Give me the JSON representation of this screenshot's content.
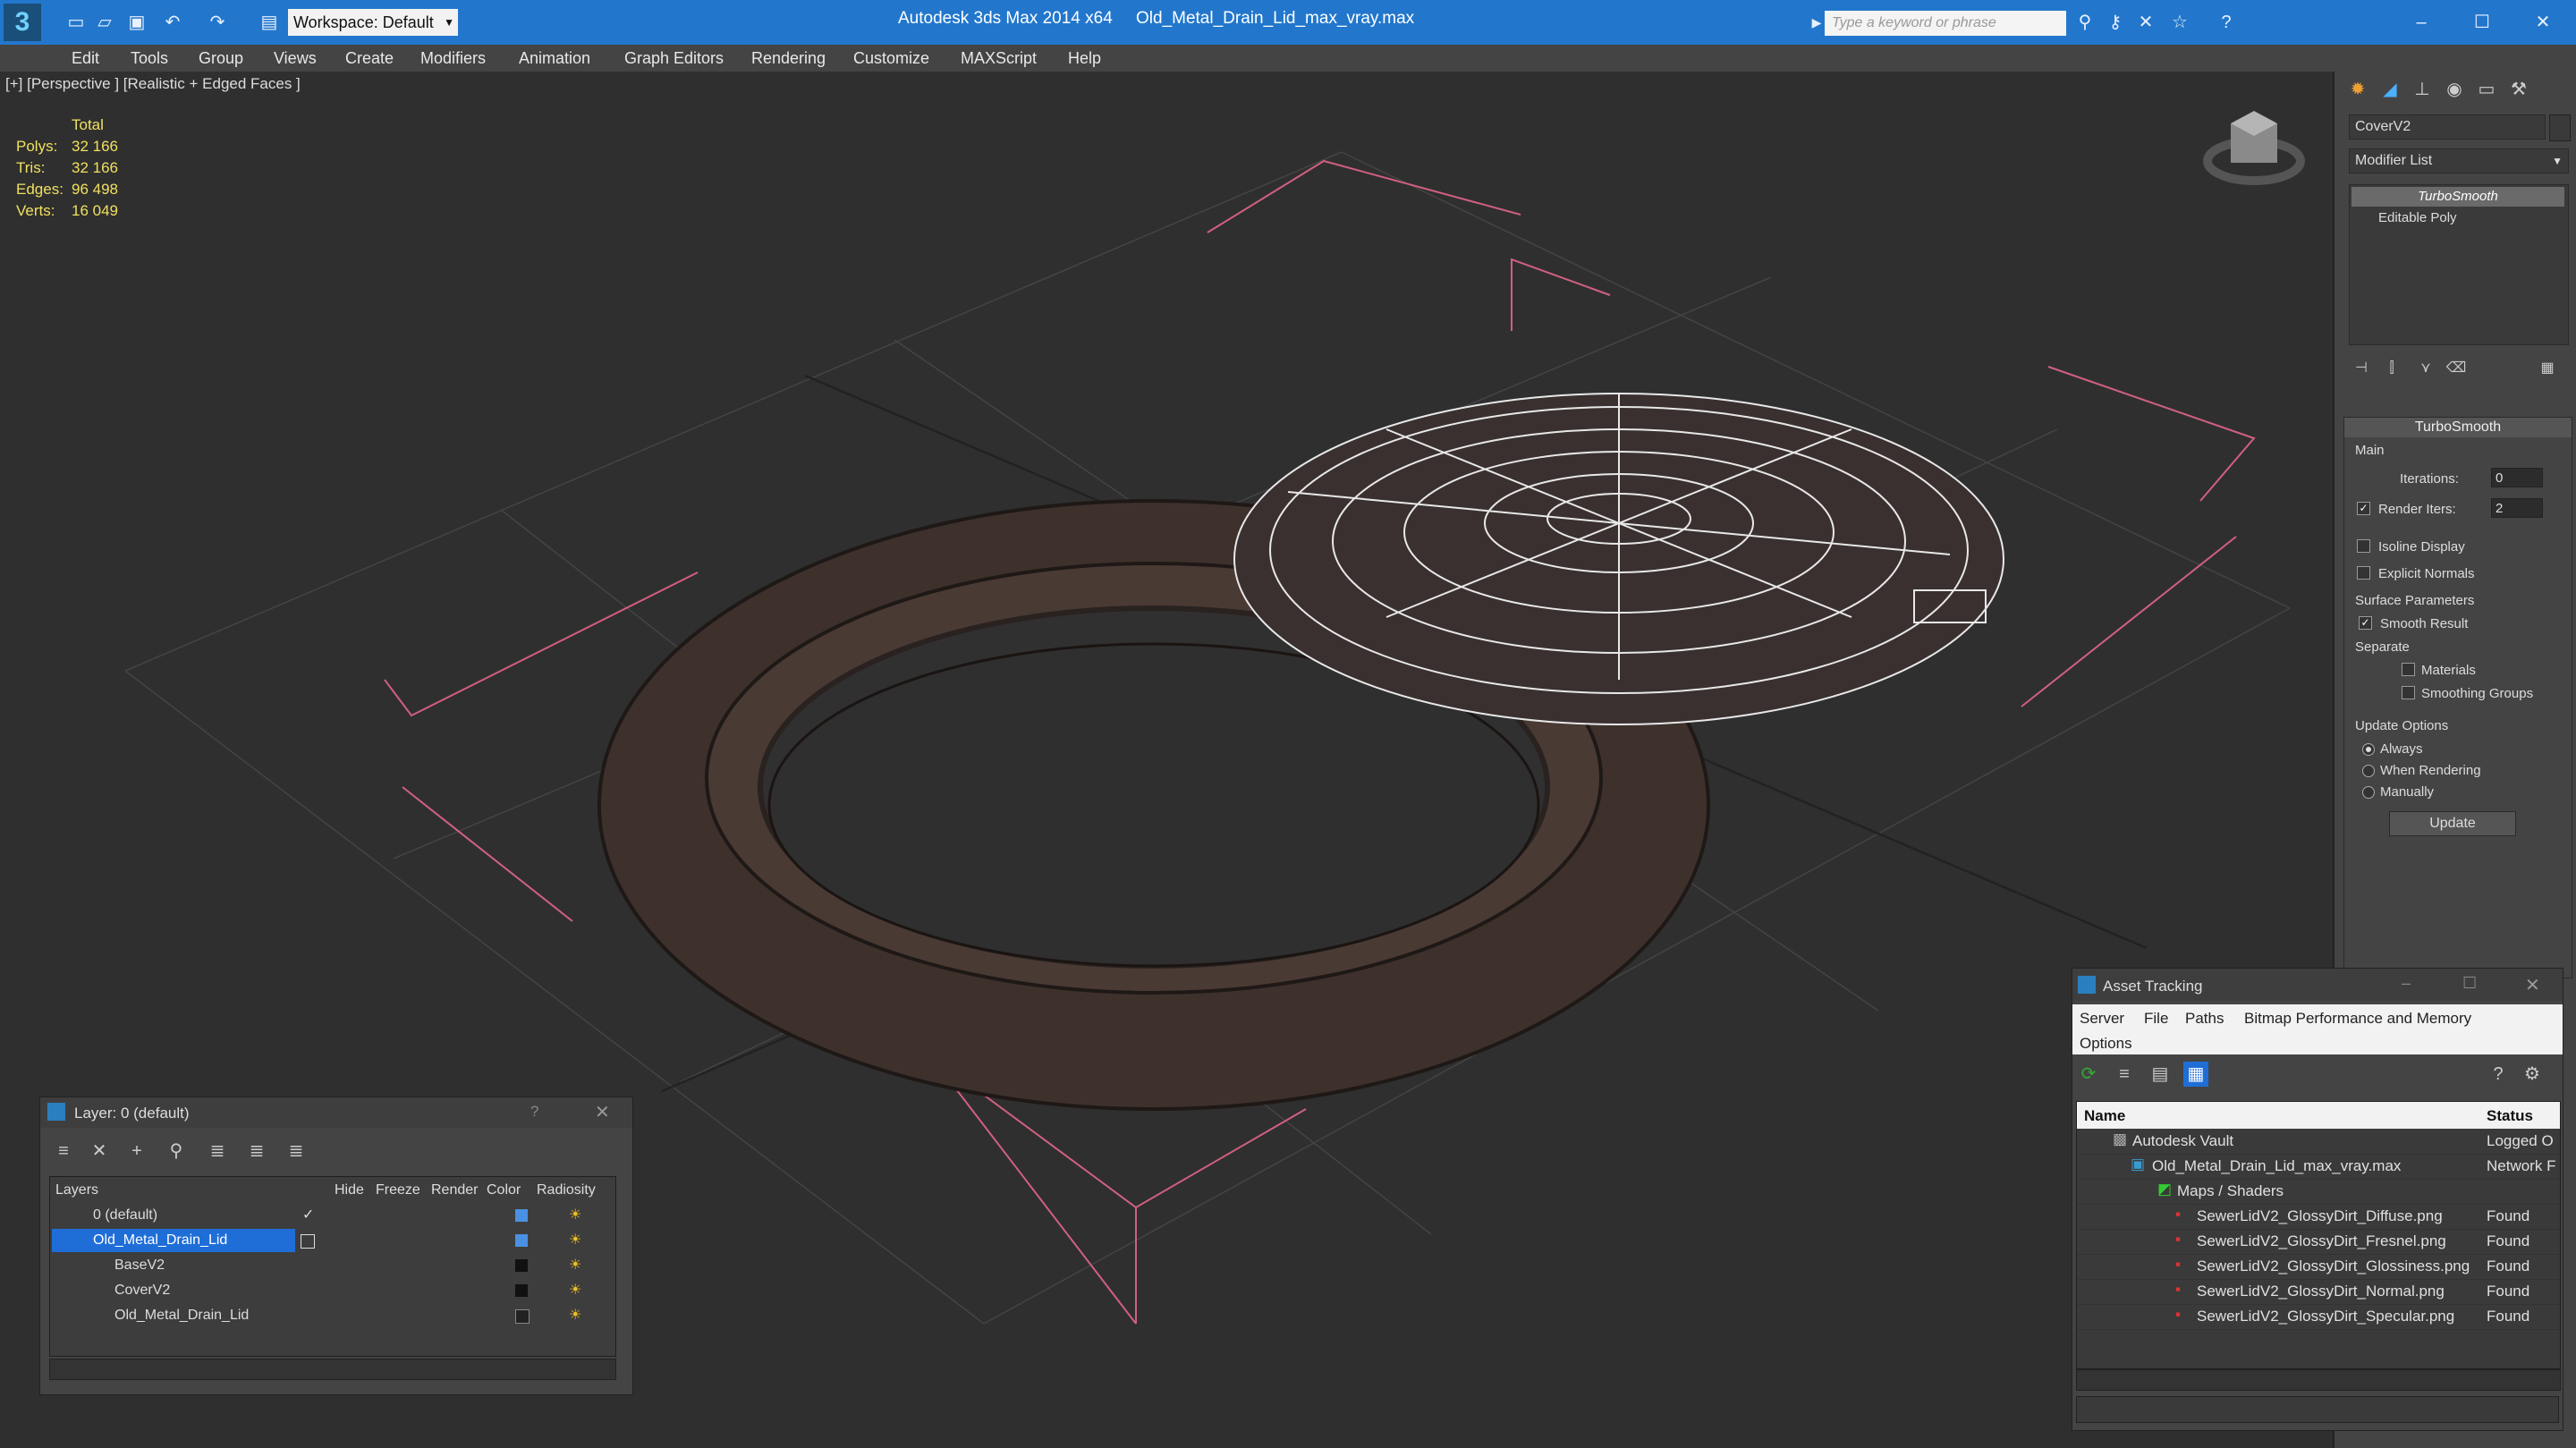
{
  "app": {
    "title": "Autodesk 3ds Max  2014 x64",
    "file": "Old_Metal_Drain_Lid_max_vray.max",
    "workspace": "Workspace: Default",
    "search_placeholder": "Type a keyword or phrase"
  },
  "menu": [
    "Edit",
    "Tools",
    "Group",
    "Views",
    "Create",
    "Modifiers",
    "Animation",
    "Graph Editors",
    "Rendering",
    "Customize",
    "MAXScript",
    "Help"
  ],
  "viewport": {
    "label": "[+] [Perspective ] [Realistic + Edged Faces ]",
    "stats_header": "Total",
    "stats": [
      {
        "k": "Polys:",
        "v": "32 166"
      },
      {
        "k": "Tris:",
        "v": "32 166"
      },
      {
        "k": "Edges:",
        "v": "96 498"
      },
      {
        "k": "Verts:",
        "v": "16 049"
      }
    ]
  },
  "command_panel": {
    "object_name": "CoverV2",
    "modifier_list": "Modifier List",
    "stack": [
      "TurboSmooth",
      "Editable Poly"
    ],
    "rollout_title": "TurboSmooth",
    "main_label": "Main",
    "iterations_label": "Iterations:",
    "iterations_value": "0",
    "render_iters_label": "Render Iters:",
    "render_iters_value": "2",
    "isoline": "Isoline Display",
    "explicit_normals": "Explicit Normals",
    "surface_params": "Surface Parameters",
    "smooth_result": "Smooth Result",
    "separate": "Separate",
    "materials": "Materials",
    "smoothing_groups": "Smoothing Groups",
    "update_options": "Update Options",
    "always": "Always",
    "when_rendering": "When Rendering",
    "manually": "Manually",
    "update_btn": "Update"
  },
  "layer_window": {
    "title": "Layer: 0 (default)",
    "columns": [
      "Layers",
      "Hide",
      "Freeze",
      "Render",
      "Color",
      "Radiosity"
    ],
    "rows": [
      {
        "name": "0 (default)",
        "color": "#4a90e2"
      },
      {
        "name": "Old_Metal_Drain_Lid",
        "color": "#4a90e2"
      },
      {
        "name": "BaseV2",
        "color": "#111111"
      },
      {
        "name": "CoverV2",
        "color": "#111111"
      },
      {
        "name": "Old_Metal_Drain_Lid",
        "color": "#222222"
      }
    ]
  },
  "asset_window": {
    "title": "Asset Tracking",
    "menu": [
      "Server",
      "File",
      "Paths",
      "Bitmap Performance and Memory",
      "Options"
    ],
    "columns": [
      "Name",
      "Status"
    ],
    "rows": [
      {
        "name": "Autodesk Vault",
        "status": "Logged O"
      },
      {
        "name": "Old_Metal_Drain_Lid_max_vray.max",
        "status": "Network F"
      },
      {
        "name": "Maps / Shaders",
        "status": ""
      },
      {
        "name": "SewerLidV2_GlossyDirt_Diffuse.png",
        "status": "Found"
      },
      {
        "name": "SewerLidV2_GlossyDirt_Fresnel.png",
        "status": "Found"
      },
      {
        "name": "SewerLidV2_GlossyDirt_Glossiness.png",
        "status": "Found"
      },
      {
        "name": "SewerLidV2_GlossyDirt_Normal.png",
        "status": "Found"
      },
      {
        "name": "SewerLidV2_GlossyDirt_Specular.png",
        "status": "Found"
      }
    ]
  }
}
